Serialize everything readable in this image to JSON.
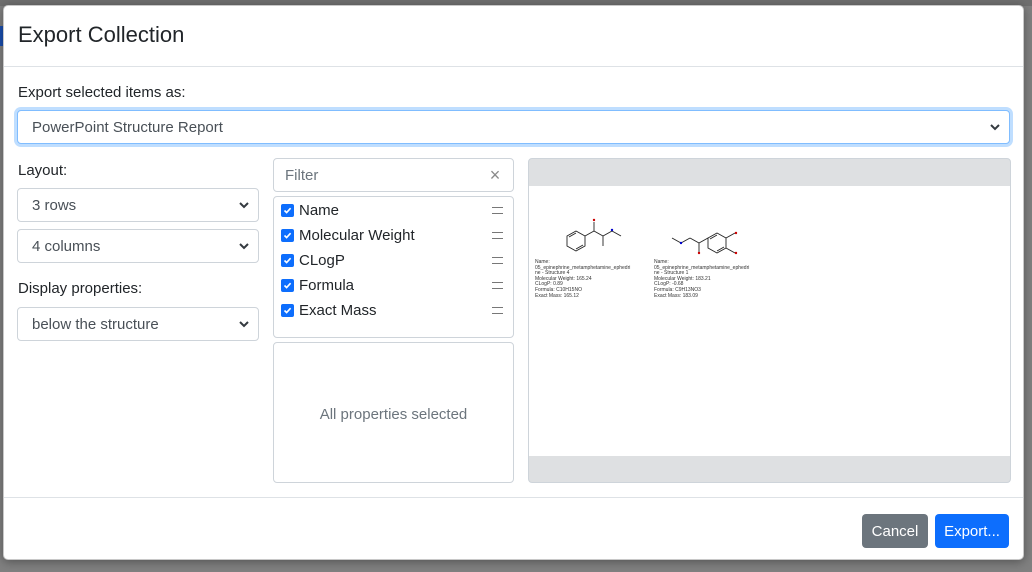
{
  "dialog": {
    "title": "Export Collection",
    "export_label": "Export selected items as:",
    "export_format": "PowerPoint Structure Report"
  },
  "layout": {
    "label": "Layout:",
    "rows": "3 rows",
    "columns": "4 columns",
    "display_label": "Display properties:",
    "display_value": "below the structure"
  },
  "filter": {
    "placeholder": "Filter",
    "clear_icon": "×"
  },
  "properties": {
    "selected": [
      {
        "label": "Name",
        "checked": true
      },
      {
        "label": "Molecular Weight",
        "checked": true
      },
      {
        "label": "CLogP",
        "checked": true
      },
      {
        "label": "Formula",
        "checked": true
      },
      {
        "label": "Exact Mass",
        "checked": true
      }
    ],
    "available_empty_text": "All properties selected"
  },
  "preview": {
    "cards": [
      {
        "name_label": "Name:",
        "name": "05_epinephrine_metamphetamine_ephedri",
        "name2": "ne - Structure 4",
        "mw": "Molecular Weight: 165.24",
        "clogp": "CLogP: 0.89",
        "formula": "Formula: C10H15NO",
        "exact_mass": "Exact Mass: 165.12"
      },
      {
        "name_label": "Name:",
        "name": "05_epinephrine_metamphetamine_ephedri",
        "name2": "ne - Structure 1",
        "mw": "Molecular Weight: 183.21",
        "clogp": "CLogP: -0.68",
        "formula": "Formula: C9H13NO3",
        "exact_mass": "Exact Mass: 183.09"
      }
    ]
  },
  "footer": {
    "cancel_label": "Cancel",
    "export_label": "Export..."
  },
  "colors": {
    "primary": "#0d6efd",
    "secondary": "#6c757d"
  }
}
